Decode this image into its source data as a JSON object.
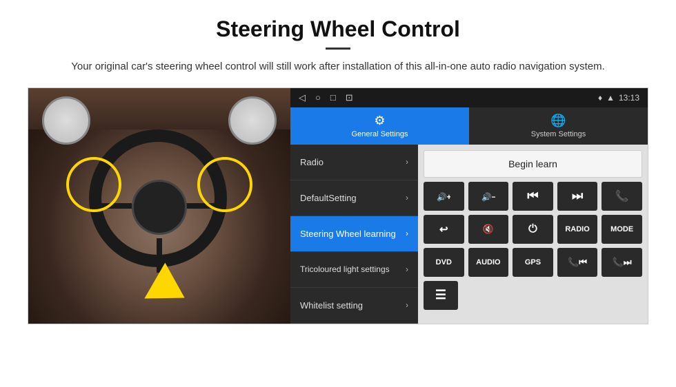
{
  "header": {
    "title": "Steering Wheel Control",
    "subtitle": "Your original car's steering wheel control will still work after installation of this all-in-one auto radio navigation system."
  },
  "android_ui": {
    "status_bar": {
      "time": "13:13",
      "nav_icons": [
        "◁",
        "○",
        "□",
        "⊡"
      ]
    },
    "tabs": [
      {
        "id": "general",
        "label": "General Settings",
        "active": true
      },
      {
        "id": "system",
        "label": "System Settings",
        "active": false
      }
    ],
    "menu_items": [
      {
        "id": "radio",
        "label": "Radio",
        "active": false
      },
      {
        "id": "default",
        "label": "DefaultSetting",
        "active": false
      },
      {
        "id": "steering",
        "label": "Steering Wheel learning",
        "active": true
      },
      {
        "id": "tricolour",
        "label": "Tricoloured light settings",
        "active": false
      },
      {
        "id": "whitelist",
        "label": "Whitelist setting",
        "active": false
      }
    ],
    "controls": {
      "begin_learn_label": "Begin learn",
      "row1": [
        "🔊+",
        "🔊−",
        "⏮",
        "⏭",
        "📞"
      ],
      "row2": [
        "↩",
        "🔊✕",
        "⏻",
        "RADIO",
        "MODE"
      ],
      "row3": [
        "DVD",
        "AUDIO",
        "GPS",
        "📞⏮",
        "📞⏭"
      ]
    }
  }
}
